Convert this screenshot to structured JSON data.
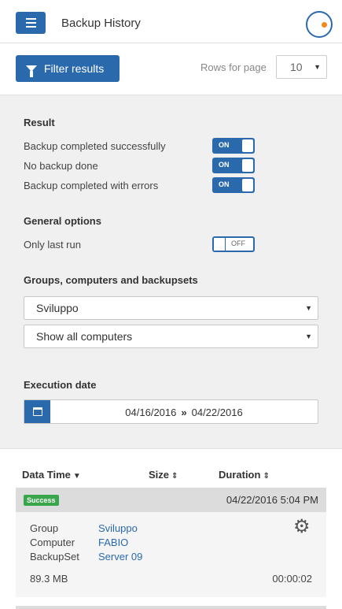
{
  "header": {
    "title": "Backup History",
    "menu_icon": "hamburger-icon",
    "logo_icon": "app-logo-icon",
    "accent": "#2a6aac",
    "logo_dot": "#f08a1c"
  },
  "toolbar": {
    "filter_label": "Filter results",
    "rows_label": "Rows for page",
    "rows_value": "10"
  },
  "filters": {
    "result_title": "Result",
    "result_options": [
      {
        "label": "Backup completed successfully",
        "state": "ON"
      },
      {
        "label": "No backup done",
        "state": "ON"
      },
      {
        "label": "Backup completed with errors",
        "state": "ON"
      }
    ],
    "general_title": "General options",
    "general_options": [
      {
        "label": "Only last run",
        "state": "OFF"
      }
    ],
    "groups_title": "Groups, computers and backupsets",
    "group_select": "Sviluppo",
    "computer_select": "Show all computers",
    "date_title": "Execution date",
    "date_from": "04/16/2016",
    "date_sep": "»",
    "date_to": "04/22/2016"
  },
  "table": {
    "col_datetime": "Data Time",
    "col_size": "Size",
    "col_duration": "Duration",
    "rows": [
      {
        "status": "Success",
        "status_color": "#3aa64c",
        "datetime": "04/22/2016 5:04 PM",
        "group_key": "Group",
        "group_val": "Sviluppo",
        "computer_key": "Computer",
        "computer_val": "FABIO",
        "backupset_key": "BackupSet",
        "backupset_val": "Server 09",
        "size": "89.3 MB",
        "duration": "00:00:02"
      }
    ]
  }
}
